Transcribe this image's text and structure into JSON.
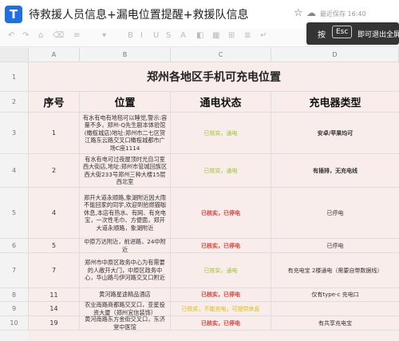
{
  "app": {
    "logo": "T",
    "title": "待救援人员信息+漏电位置提醒+救援队信息",
    "saved_status": "最近保存 16:40"
  },
  "toolbar_icons": [
    "undo-icon",
    "redo-icon",
    "format-paint-icon",
    "clear-format-icon",
    "text-style-icon",
    "font-size-icon",
    "bold-icon",
    "italic-icon",
    "underline-icon",
    "strikethrough-icon",
    "font-color-icon",
    "fill-color-icon",
    "border-icon",
    "merge-icon",
    "align-icon",
    "wrap-icon"
  ],
  "fullscreen_overlay": {
    "press": "按",
    "key": "Esc",
    "text": "即可退出全屏模式"
  },
  "columns": [
    "A",
    "B",
    "C",
    "D"
  ],
  "sheet": {
    "title": "郑州各地区手机可充电位置",
    "headers": {
      "index": "序号",
      "location": "位置",
      "power": "通电状态",
      "charger": "充电器类型"
    },
    "rows": [
      {
        "row": "3",
        "index": "1",
        "location": "有水有电有地毯可以睡觉,警示:容量不多，郑州-Q先生剧本体验馆(橄榄城店)地址:郑州市二七区贺江路东云路交叉口橄榄城都市广场C座1114",
        "power": "已核实，通电",
        "power_status": "ok",
        "charger": "安卓/苹果均可",
        "charger_bold": true
      },
      {
        "row": "4",
        "index": "2",
        "location": "有水有电可过夜屋顶时光自习室西大街店,地址:郑州市管城回族区西大街233号郑州三种大楼15层西北室",
        "power": "已核实，通电",
        "power_status": "ok",
        "charger": "有插排，无充电线",
        "charger_bold": true
      },
      {
        "row": "5",
        "index": "4",
        "location": "郑开大道永顺路,象湖附近因大雨不能回家的同学,欢迎到拾燃猫咖休息,本店有热水、有网、有充电宝，一次性毛巾、方便面，郑开大道永顺路，象湖附近",
        "power": "已核实，已停电",
        "power_status": "no",
        "charger": "已停电",
        "charger_bold": false
      },
      {
        "row": "6",
        "index": "5",
        "location": "中原万达附近，前进路，24中附近",
        "power": "已核实，已停电",
        "power_status": "no",
        "charger": "已停电",
        "charger_bold": false
      },
      {
        "row": "7",
        "index": "7",
        "location": "郑州市中原区政务中心为有需要的人敞开大门，中原区政务中心，华山路与伊河路交叉口附近",
        "power": "已核实，通电",
        "power_status": "ok",
        "charger": "有充电宝 2楼通电（需要自带数据线）",
        "charger_bold": false
      },
      {
        "row": "8",
        "index": "11",
        "location": "黄河路星途精品酒店",
        "power": "已核实，已停电",
        "power_status": "no",
        "charger": "仅有type-c 充电口",
        "charger_bold": false
      },
      {
        "row": "9",
        "index": "14",
        "location": "农业南路商都路交叉口，亚星投资大厦（郑州宜信装饰）",
        "power": "已核实，不能充电，可提供休息",
        "power_status": "warn",
        "charger": "",
        "charger_bold": false
      },
      {
        "row": "10",
        "index": "19",
        "location": "黄河南路东方金街交叉口，东济堂中医馆",
        "power": "已核实，已停电",
        "power_status": "no",
        "charger": "有共享充电宝",
        "charger_bold": false
      }
    ]
  }
}
